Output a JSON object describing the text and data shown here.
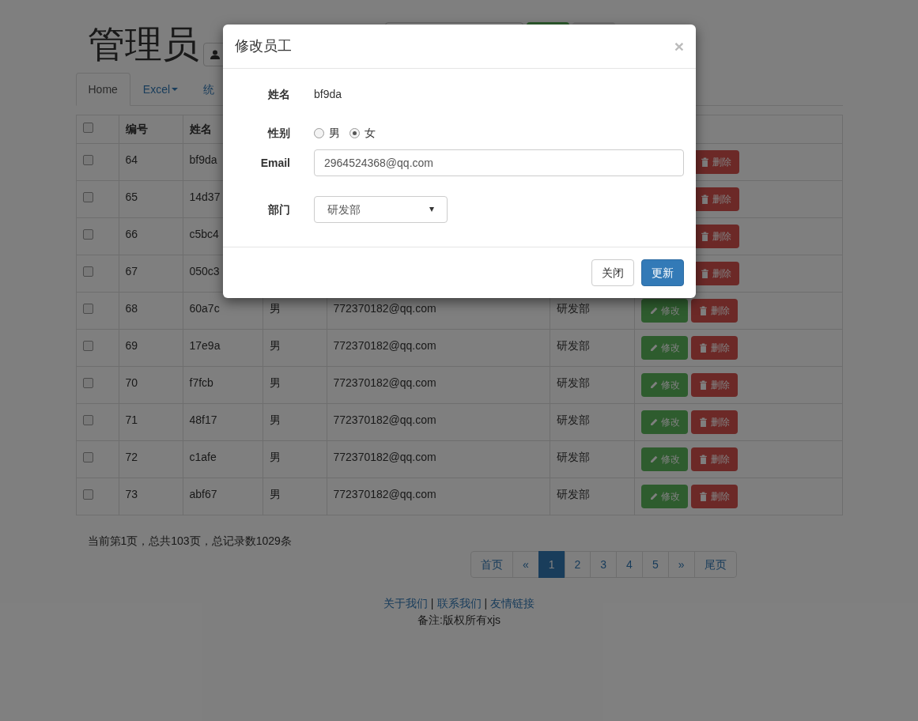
{
  "header": {
    "title": "管理员"
  },
  "tabs": [
    {
      "label": "Home",
      "selected": true,
      "caret": false
    },
    {
      "label": "Excel",
      "selected": false,
      "caret": true
    },
    {
      "label": "统",
      "selected": false,
      "caret": false
    }
  ],
  "table": {
    "columns": [
      "编号",
      "姓名"
    ],
    "select_all": {
      "checked": false
    },
    "rows": [
      {
        "id": "64",
        "name": "bf9da",
        "checked": false,
        "delete": "删除"
      },
      {
        "id": "65",
        "name": "14d37",
        "checked": false,
        "delete": "删除"
      },
      {
        "id": "66",
        "name": "c5bc4",
        "checked": false,
        "delete": "删除"
      },
      {
        "id": "67",
        "name": "050c3",
        "checked": false,
        "delete": "删除"
      },
      {
        "id": "68",
        "name": "60a7c",
        "gender": "男",
        "email": "772370182@qq.com",
        "dept": "研发部",
        "checked": false,
        "edit": "修改",
        "delete": "删除"
      },
      {
        "id": "69",
        "name": "17e9a",
        "gender": "男",
        "email": "772370182@qq.com",
        "dept": "研发部",
        "checked": false,
        "edit": "修改",
        "delete": "删除"
      },
      {
        "id": "70",
        "name": "f7fcb",
        "gender": "男",
        "email": "772370182@qq.com",
        "dept": "研发部",
        "checked": false,
        "edit": "修改",
        "delete": "删除"
      },
      {
        "id": "71",
        "name": "48f17",
        "gender": "男",
        "email": "772370182@qq.com",
        "dept": "研发部",
        "checked": false,
        "edit": "修改",
        "delete": "删除"
      },
      {
        "id": "72",
        "name": "c1afe",
        "gender": "男",
        "email": "772370182@qq.com",
        "dept": "研发部",
        "checked": false,
        "edit": "修改",
        "delete": "删除"
      },
      {
        "id": "73",
        "name": "abf67",
        "gender": "男",
        "email": "772370182@qq.com",
        "dept": "研发部",
        "checked": false,
        "edit": "修改",
        "delete": "删除"
      }
    ]
  },
  "page_info": "当前第1页，总共103页，总记录数1029条",
  "pagination": [
    {
      "label": "首页",
      "selected": false
    },
    {
      "label": "«",
      "selected": false
    },
    {
      "label": "1",
      "selected": true
    },
    {
      "label": "2",
      "selected": false
    },
    {
      "label": "3",
      "selected": false
    },
    {
      "label": "4",
      "selected": false
    },
    {
      "label": "5",
      "selected": false
    },
    {
      "label": "»",
      "selected": false
    },
    {
      "label": "尾页",
      "selected": false
    }
  ],
  "footer": {
    "links": [
      "关于我们",
      "联系我们",
      "友情链接"
    ],
    "separator": "|",
    "note": "备注:版权所有xjs"
  },
  "modal": {
    "title": "修改员工",
    "close": "×",
    "name_label": "姓名",
    "name_value": "bf9da",
    "gender_label": "性别",
    "gender_options": [
      {
        "label": "男",
        "selected": false
      },
      {
        "label": "女",
        "selected": true
      }
    ],
    "email_label": "Email",
    "email_value": "2964524368@qq.com",
    "dept_label": "部门",
    "dept_value": "研发部",
    "buttons": [
      {
        "label": "关闭",
        "kind": "default"
      },
      {
        "label": "更新",
        "kind": "primary"
      }
    ]
  }
}
